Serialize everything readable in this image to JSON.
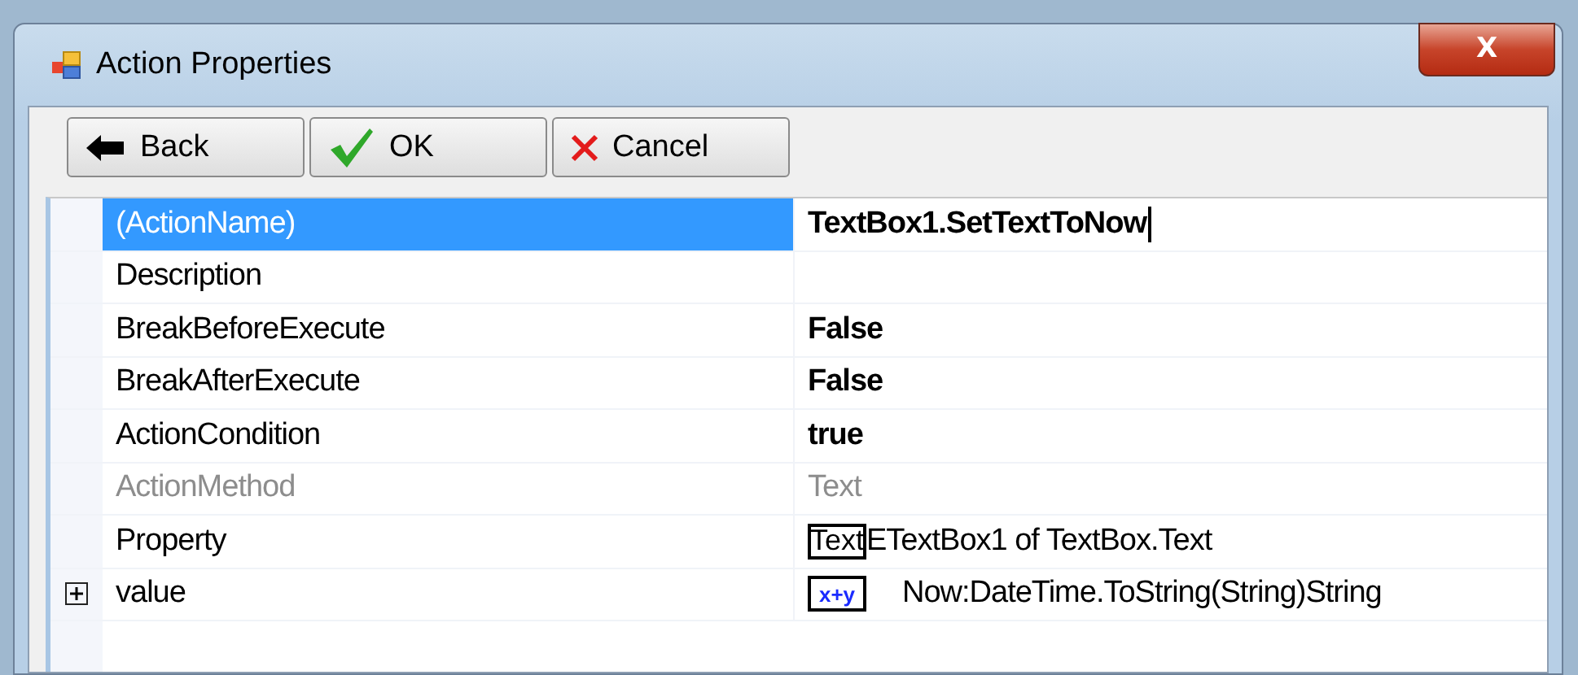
{
  "window": {
    "title": "Action Properties",
    "close": "X"
  },
  "toolbar": [
    {
      "kind": "back",
      "label": "Back"
    },
    {
      "kind": "ok",
      "label": "OK"
    },
    {
      "kind": "cancel",
      "label": "Cancel"
    }
  ],
  "grid": {
    "rows": [
      {
        "name": "(ActionName)",
        "value": "TextBox1.SetTextToNow",
        "kind": "text",
        "selected": true,
        "disabled": false,
        "bold": true
      },
      {
        "name": "Description",
        "value": null,
        "kind": "text",
        "selected": false,
        "disabled": false
      },
      {
        "name": "BreakBeforeExecute",
        "value": "False",
        "kind": "text",
        "selected": false,
        "disabled": false,
        "bold": true
      },
      {
        "name": "BreakAfterExecute",
        "value": "False",
        "kind": "text",
        "selected": false,
        "disabled": false,
        "bold": true
      },
      {
        "name": "ActionCondition",
        "value": "true",
        "kind": "text",
        "selected": false,
        "disabled": false,
        "bold": true
      },
      {
        "name": "ActionMethod",
        "value": "Text",
        "kind": "text",
        "selected": false,
        "disabled": true,
        "bold": false
      },
      {
        "name": "Property",
        "value": "ETextBox1 of TextBox.Text",
        "icon_text": "Text",
        "kind": "property",
        "selected": false,
        "disabled": false,
        "bold": false
      },
      {
        "name": "value",
        "value": "Now:DateTime.ToString(String)String",
        "icon_text": "x+y",
        "kind": "expression",
        "selected": false,
        "disabled": false,
        "bold": false,
        "expanded": false
      }
    ]
  }
}
